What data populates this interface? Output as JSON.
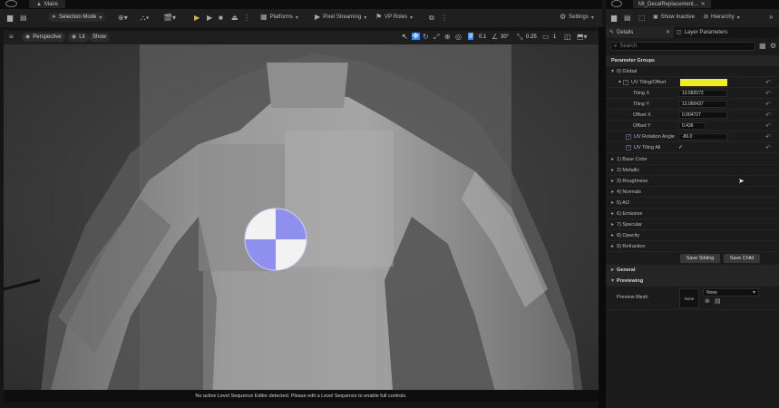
{
  "editor": {
    "level_tab": "Maire",
    "mode": "Selection Mode",
    "platforms": "Platforms",
    "pixel_streaming": "Pixel Streaming",
    "vp_roles": "VP Roles",
    "settings": "Settings"
  },
  "viewport": {
    "perspective": "Perspective",
    "lit": "Lit",
    "show": "Show",
    "grid_snap": "0.1",
    "rot_snap": "30°",
    "scale_snap": "0.25",
    "cam_speed": "1",
    "status_text": "No active Level Sequence Editor detected. Please edit a Level Sequence to enable full controls."
  },
  "panel": {
    "tab_title": "MI_DecalReplacement...",
    "show_inactive": "Show Inactive",
    "hierarchy": "Hierarchy",
    "details_tab": "Details",
    "layer_params_tab": "Layer Parameters",
    "search_placeholder": "Search",
    "param_groups": "Parameter Groups",
    "global": "0) Global",
    "uv_tiling_offset": "UV Tiling/Offset",
    "tiling_x_label": "Tiling X",
    "tiling_x": "13.682072",
    "tiling_y_label": "Tiling Y",
    "tiling_y": "13.060437",
    "offset_x_label": "Offset X",
    "offset_x": "0.004727",
    "offset_y_label": "Offset Y",
    "offset_y": "0.436",
    "uv_rotation_label": "UV Rotation Angle",
    "uv_rotation": "-86.0",
    "uv_tiling_all": "UV Tiling All",
    "groups": [
      "1) Base Color",
      "2) Metallic",
      "3) Roughness",
      "4) Normals",
      "5) AO",
      "6) Emissive",
      "7) Specular",
      "8) Opacity",
      "9) Refraction"
    ],
    "save_sibling": "Save Sibling",
    "save_child": "Save Child",
    "general": "General",
    "previewing": "Previewing",
    "preview_mesh_label": "Preview Mesh",
    "preview_mesh_value": "None",
    "none_thumb": "None"
  },
  "colors": {
    "uv_tiling_swatch": "#f2ec1c",
    "accent": "#2f8cff"
  }
}
